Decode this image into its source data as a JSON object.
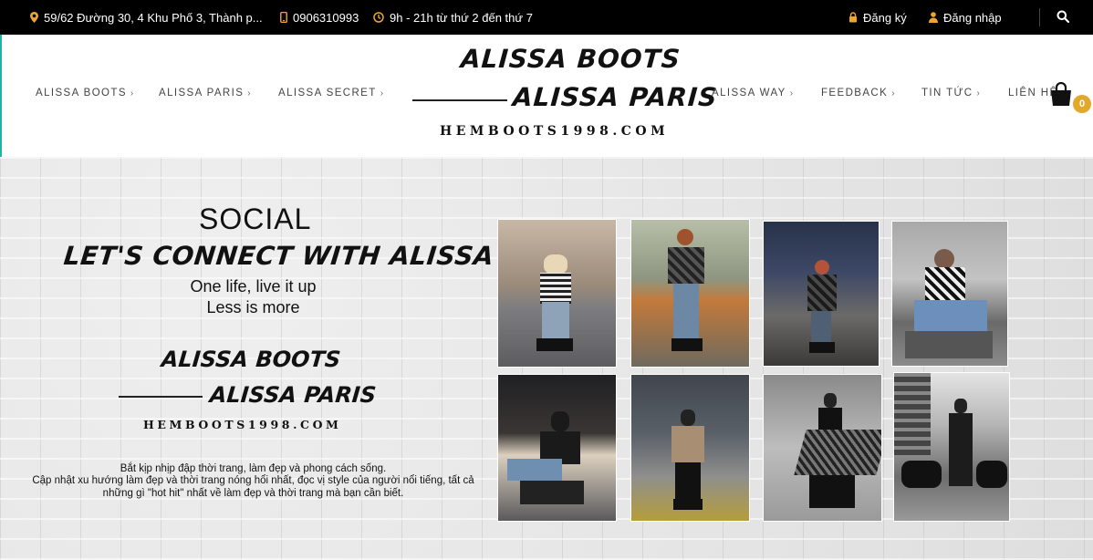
{
  "topbar": {
    "address": "59/62 Đường 30, 4 Khu Phố 3, Thành p...",
    "phone": "0906310993",
    "hours": "9h - 21h từ thứ 2 đến thứ 7",
    "register": "Đăng ký",
    "login": "Đăng nhập",
    "icons": [
      "map-pin-icon",
      "phone-icon",
      "clock-icon",
      "lock-icon",
      "user-icon",
      "search-icon"
    ],
    "accent": "#f0a52c"
  },
  "nav": {
    "left": [
      "ALISSA BOOTS",
      "ALISSA PARIS",
      "ALISSA SECRET"
    ],
    "right": [
      "ALISSA WAY",
      "FEEDBACK",
      "TIN TỨC",
      "LIÊN HỆ"
    ]
  },
  "logo": {
    "line1": "ALISSA BOOTS",
    "line2": "ALISSA PARIS",
    "url": "HEMBOOTS1998.COM"
  },
  "cart": {
    "count": "0",
    "badge_color": "#e2a82b"
  },
  "banner": {
    "title": "SOCIAL",
    "connect": "LET'S CONNECT WITH ALISSA",
    "tagline1": "One life, live it up",
    "tagline2": "Less is more",
    "logo_line1": "ALISSA BOOTS",
    "logo_line2": "ALISSA PARIS",
    "logo_url": "HEMBOOTS1998.COM",
    "desc1": "Bắt kịp nhịp đập thời trang, làm đẹp và phong cách sống.",
    "desc2": "Cập nhật xu hướng làm đẹp và thời trang nóng hổi nhất, đọc vị style của người nổi tiếng, tất cả những gì \"hot hit\" nhất về làm đẹp và thời trang mà bạn cần biết."
  }
}
